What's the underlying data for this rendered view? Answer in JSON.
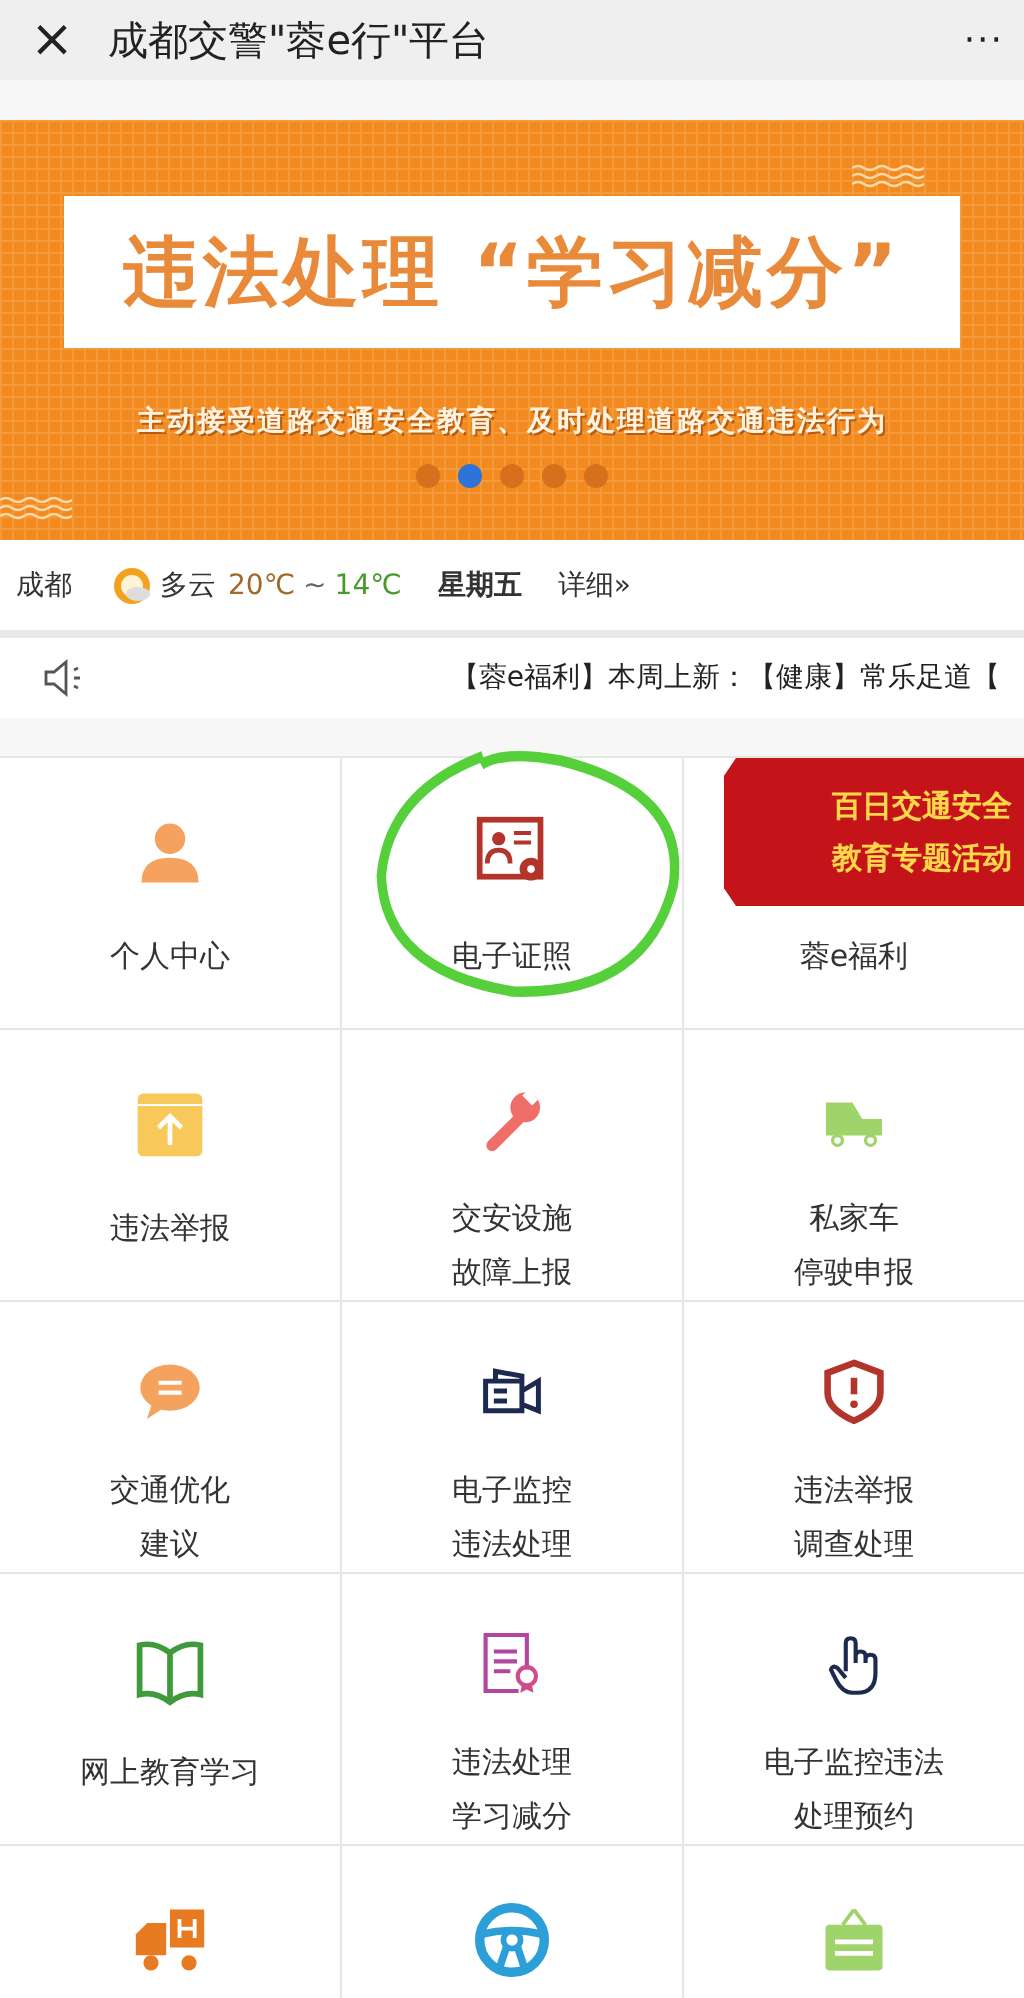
{
  "window": {
    "close": "×",
    "title": "成都交警\"蓉e行\"平台",
    "more": "···"
  },
  "banner": {
    "headline": "违法处理 “学习减分”",
    "subline": "主动接受道路交通安全教育、及时处理道路交通违法行为",
    "dots": [
      {
        "selected": false
      },
      {
        "selected": true
      },
      {
        "selected": false
      },
      {
        "selected": false
      },
      {
        "selected": false
      }
    ]
  },
  "weather": {
    "city": "成都",
    "condition": "多云",
    "high": "20℃",
    "separator": "~",
    "low": "14℃",
    "weekday": "星期五",
    "details": "详细»"
  },
  "notice": {
    "text": "【蓉e福利】本周上新：【健康】常乐足道【"
  },
  "grid": [
    {
      "kind": "person",
      "lines": [
        "个人中心"
      ],
      "circled": false
    },
    {
      "kind": "certificate",
      "lines": [
        "电子证照"
      ],
      "circled": true
    },
    {
      "kind": "none",
      "lines": [
        "蓉e福利"
      ],
      "circled": false,
      "ribbon": [
        "百日交通安全",
        "教育专题活动"
      ]
    },
    {
      "kind": "upload",
      "lines": [
        "违法举报"
      ],
      "circled": false
    },
    {
      "kind": "wrench",
      "lines": [
        "交安设施",
        "故障上报"
      ],
      "circled": false
    },
    {
      "kind": "car",
      "lines": [
        "私家车",
        "停驶申报"
      ],
      "circled": false
    },
    {
      "kind": "chat",
      "lines": [
        "交通优化",
        "建议"
      ],
      "circled": false
    },
    {
      "kind": "camera",
      "lines": [
        "电子监控",
        "违法处理"
      ],
      "circled": false
    },
    {
      "kind": "shield",
      "lines": [
        "违法举报",
        "调查处理"
      ],
      "circled": false
    },
    {
      "kind": "book",
      "lines": [
        "网上教育学习"
      ],
      "circled": false
    },
    {
      "kind": "document",
      "lines": [
        "违法处理",
        "学习减分"
      ],
      "circled": false
    },
    {
      "kind": "hand",
      "lines": [
        "电子监控违法",
        "处理预约"
      ],
      "circled": false
    },
    {
      "kind": "truck"
    },
    {
      "kind": "wheel"
    },
    {
      "kind": "bag"
    }
  ]
}
